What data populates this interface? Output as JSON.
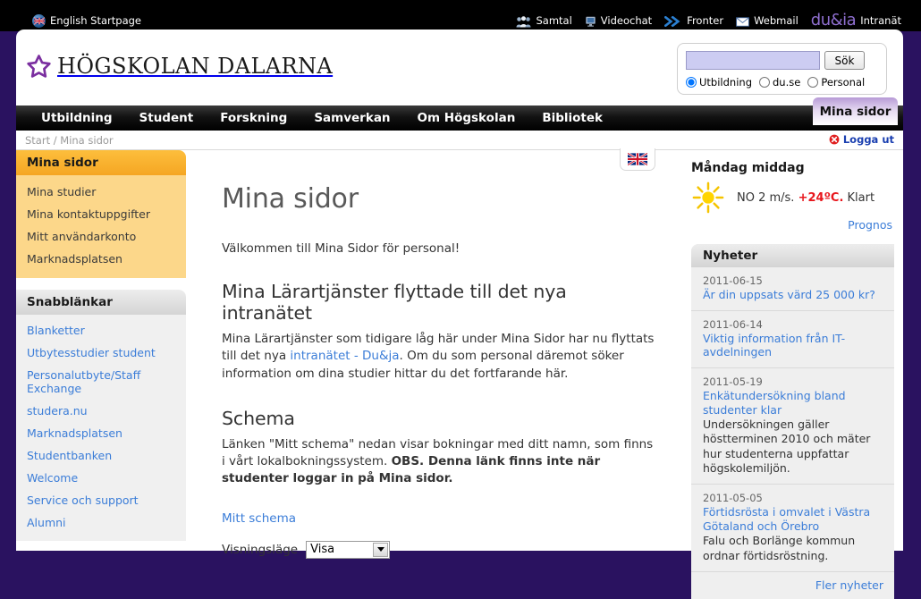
{
  "topbar": {
    "english_link": "English Startpage",
    "links": [
      {
        "label": "Samtal",
        "icon": "people-icon"
      },
      {
        "label": "Videochat",
        "icon": "monitor-icon"
      },
      {
        "label": "Fronter",
        "icon": "double-chevron-right-icon"
      },
      {
        "label": "Webmail",
        "icon": "envelope-icon"
      },
      {
        "label": "Intranät",
        "icon": "duja-logo-icon"
      }
    ],
    "duja_brand": "du&ia"
  },
  "header": {
    "logo_text": "HÖGSKOLAN DALARNA"
  },
  "search": {
    "value": "",
    "placeholder": "",
    "button_label": "Sök",
    "options": [
      {
        "label": "Utbildning",
        "selected": true
      },
      {
        "label": "du.se",
        "selected": false
      },
      {
        "label": "Personal",
        "selected": false
      }
    ]
  },
  "nav": {
    "items": [
      "Utbildning",
      "Student",
      "Forskning",
      "Samverkan",
      "Om Högskolan",
      "Bibliotek"
    ],
    "active_tab": "Mina sidor"
  },
  "breadcrumb": {
    "start": "Start",
    "separator": "/",
    "current": "Mina sidor",
    "logout_label": "Logga ut"
  },
  "sidebar": {
    "menu_title": "Mina sidor",
    "menu_items": [
      "Mina studier",
      "Mina kontaktuppgifter",
      "Mitt användarkonto",
      "Marknadsplatsen"
    ],
    "quick_title": "Snabblänkar",
    "quick_items": [
      "Blanketter",
      "Utbytesstudier student",
      "Personalutbyte/Staff Exchange",
      "studera.nu",
      "Marknadsplatsen",
      "Studentbanken",
      "Welcome",
      "Service och support",
      "Alumni"
    ]
  },
  "main": {
    "lang_flag": "uk-flag-icon",
    "title": "Mina sidor",
    "intro": "Välkommen till Mina Sidor för personal!",
    "section1": {
      "heading": "Mina Lärartjänster flyttade till det nya intranätet",
      "text_before": "Mina Lärartjänster som tidigare låg här under Mina Sidor har nu flyttats till det nya ",
      "link": "intranätet - Du&ja",
      "text_after": ". Om du som personal däremot söker information om dina studier hittar du det fortfarande här."
    },
    "section2": {
      "heading": "Schema",
      "text_normal": "Länken \"Mitt schema\" nedan visar bokningar med ditt namn, som finns i vårt lokalbokningssystem. ",
      "text_bold": "OBS. Denna länk finns inte när studenter loggar in på Mina sidor.",
      "schema_link": "Mitt schema",
      "form_label": "Visningsläge",
      "select_value": "Visa"
    }
  },
  "weather": {
    "title": "Måndag middag",
    "icon": "sun-icon",
    "wind": "NO 2 m/s.",
    "temperature": "+24ºC.",
    "condition": "Klart",
    "forecast_link": "Prognos"
  },
  "news": {
    "title": "Nyheter",
    "more_link": "Fler nyheter",
    "items": [
      {
        "date": "2011-06-15",
        "headline": "Är din uppsats värd 25 000 kr?",
        "description": ""
      },
      {
        "date": "2011-06-14",
        "headline": "Viktig information från IT-avdelningen",
        "description": ""
      },
      {
        "date": "2011-05-19",
        "headline": "Enkätundersökning bland studenter klar",
        "description": "Undersökningen gäller höstterminen 2010 och mäter hur studenterna uppfattar högskolemiljön."
      },
      {
        "date": "2011-05-05",
        "headline": "Förtidsrösta i omvalet i Västra Götaland och Örebro",
        "description": "Falu och Borlänge kommun ordnar förtidsröstning."
      }
    ]
  },
  "colors": {
    "page_background": "#2a1260",
    "accent_orange": "#f5a623",
    "link_blue": "#3b7dd8",
    "logo_purple": "#7b2fa0",
    "temp_red": "#e8161c"
  }
}
